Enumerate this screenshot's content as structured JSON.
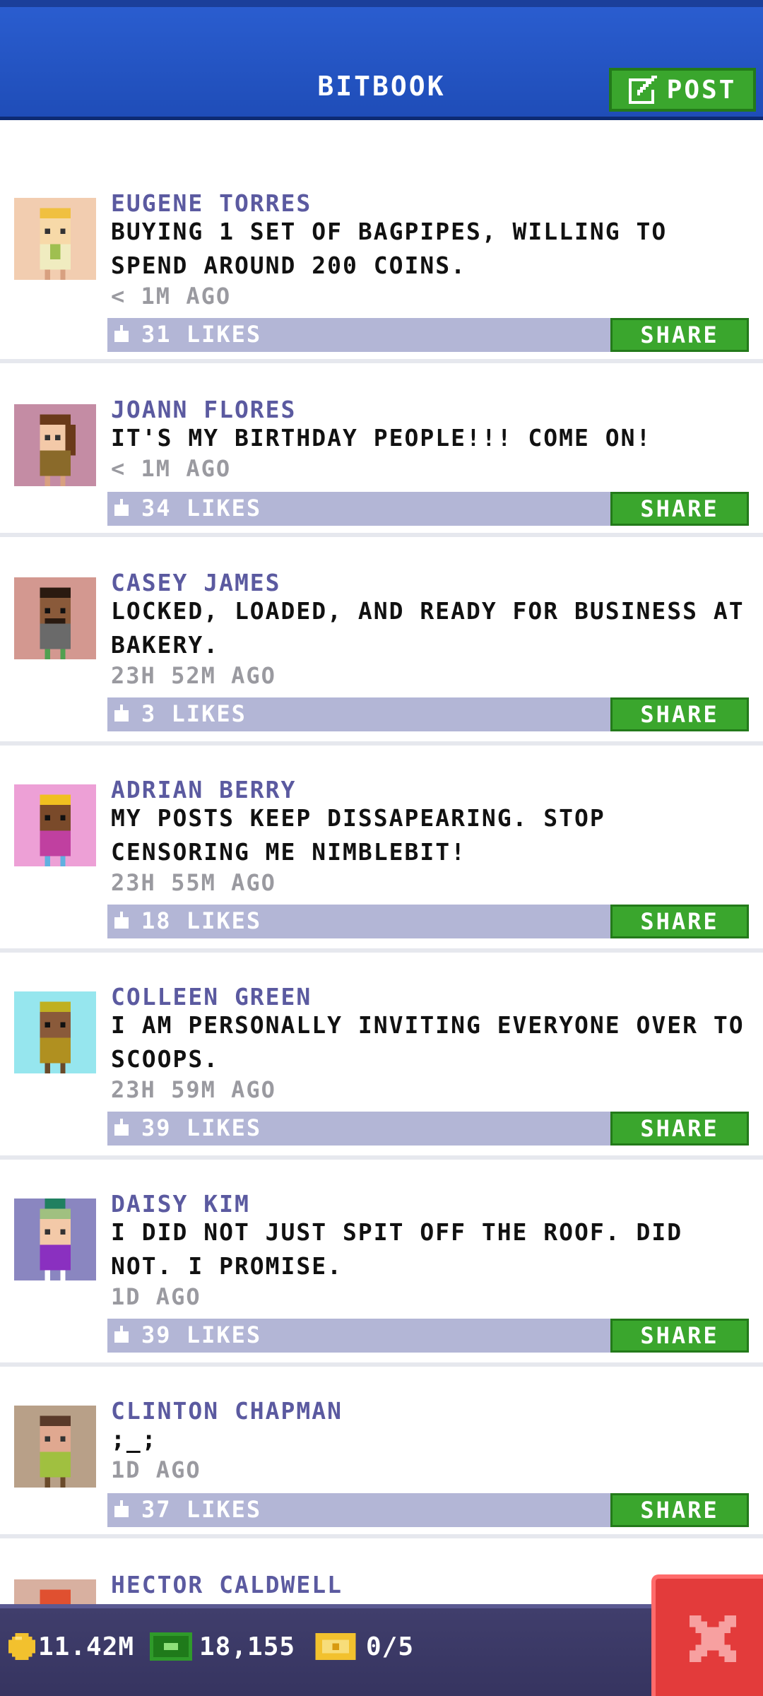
{
  "header": {
    "title": "BITBOOK",
    "post_label": "POST"
  },
  "posts": [
    {
      "author": "EUGENE TORRES",
      "message": "BUYING 1 SET OF BAGPIPES, WILLING TO SPEND AROUND 200 COINS.",
      "time": "< 1M AGO",
      "likes": "31 LIKES",
      "share": "SHARE",
      "avatar_bg": "#f2cdb0"
    },
    {
      "author": "JOANN FLORES",
      "message": "IT'S MY BIRTHDAY PEOPLE!!! COME ON!",
      "time": "< 1M AGO",
      "likes": "34 LIKES",
      "share": "SHARE",
      "avatar_bg": "#c48ca4"
    },
    {
      "author": "CASEY JAMES",
      "message": "LOCKED, LOADED, AND READY FOR BUSINESS AT BAKERY.",
      "time": "23H 52M AGO",
      "likes": "3 LIKES",
      "share": "SHARE",
      "avatar_bg": "#d39890"
    },
    {
      "author": "ADRIAN BERRY",
      "message": "MY POSTS KEEP DISSAPEARING. STOP CENSORING ME NIMBLEBIT!",
      "time": "23H 55M AGO",
      "likes": "18 LIKES",
      "share": "SHARE",
      "avatar_bg": "#eda0d6"
    },
    {
      "author": "COLLEEN GREEN",
      "message": "I AM PERSONALLY INVITING EVERYONE OVER TO SCOOPS.",
      "time": "23H 59M AGO",
      "likes": "39 LIKES",
      "share": "SHARE",
      "avatar_bg": "#96e6ee"
    },
    {
      "author": "DAISY KIM",
      "message": "I DID NOT JUST SPIT OFF THE ROOF. DID NOT. I PROMISE.",
      "time": "1D AGO",
      "likes": "39 LIKES",
      "share": "SHARE",
      "avatar_bg": "#8a86c0"
    },
    {
      "author": "CLINTON CHAPMAN",
      "message": ";_;",
      "time": "1D AGO",
      "likes": "37 LIKES",
      "share": "SHARE",
      "avatar_bg": "#b8a088"
    },
    {
      "author": "HECTOR CALDWELL",
      "message": "",
      "time": "",
      "likes": "",
      "share": "",
      "avatar_bg": "#d8b0a0"
    }
  ],
  "bottom_bar": {
    "coins": "11.42M",
    "bux": "18,155",
    "tickets": "0/5"
  },
  "colors": {
    "header": "#2a5dcf",
    "green": "#3aa62d",
    "likebar": "#b3b6d6",
    "author": "#5b5aa0",
    "close": "#e33b3b"
  },
  "icons": {
    "post": "edit-icon",
    "coin": "coin-icon",
    "bux": "bux-icon",
    "ticket": "ticket-icon",
    "like": "thumbs-up-icon",
    "close": "close-icon"
  }
}
